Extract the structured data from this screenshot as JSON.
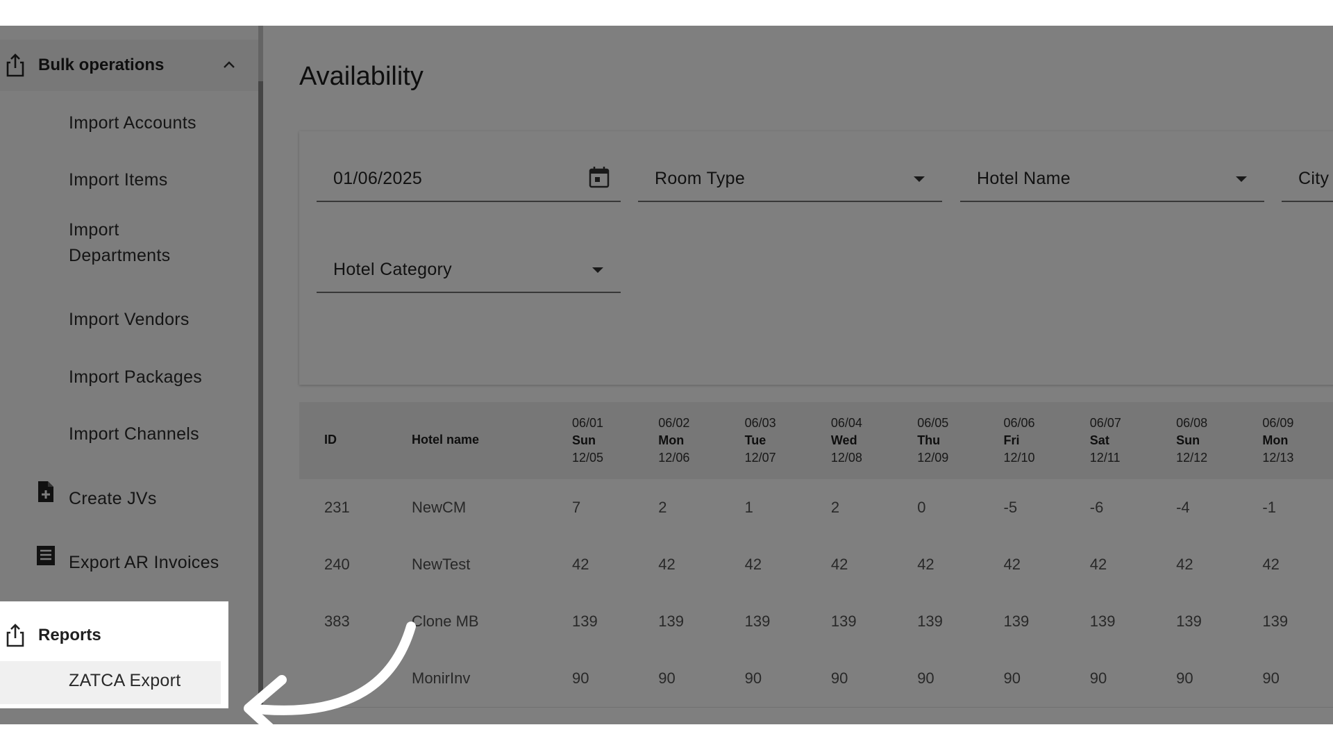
{
  "sidebar": {
    "bulk_label": "Bulk operations",
    "items": [
      {
        "label": "Import Accounts"
      },
      {
        "label": "Import Items"
      },
      {
        "label_line1": "Import",
        "label_line2": "Departments"
      },
      {
        "label": "Import Vendors"
      },
      {
        "label": "Import Packages"
      },
      {
        "label": "Import Channels"
      },
      {
        "label": "Create JVs",
        "icon": "file-plus-icon"
      },
      {
        "label": "Export AR Invoices",
        "icon": "list-document-icon"
      }
    ],
    "reports_label": "Reports",
    "reports_items": [
      {
        "label": "ZATCA Export"
      }
    ]
  },
  "main": {
    "title": "Availability",
    "filters": {
      "date": "01/06/2025",
      "room_type": "Room Type",
      "hotel_name": "Hotel Name",
      "city": "City",
      "hotel_category": "Hotel Category"
    },
    "table": {
      "col_id": "ID",
      "col_hotel": "Hotel name",
      "dates": [
        {
          "a": "06/01",
          "b": "Sun",
          "c": "12/05"
        },
        {
          "a": "06/02",
          "b": "Mon",
          "c": "12/06"
        },
        {
          "a": "06/03",
          "b": "Tue",
          "c": "12/07"
        },
        {
          "a": "06/04",
          "b": "Wed",
          "c": "12/08"
        },
        {
          "a": "06/05",
          "b": "Thu",
          "c": "12/09"
        },
        {
          "a": "06/06",
          "b": "Fri",
          "c": "12/10"
        },
        {
          "a": "06/07",
          "b": "Sat",
          "c": "12/11"
        },
        {
          "a": "06/08",
          "b": "Sun",
          "c": "12/12"
        },
        {
          "a": "06/09",
          "b": "Mon",
          "c": "12/13"
        }
      ],
      "rows": [
        {
          "id": "231",
          "name": "NewCM",
          "vals": [
            "7",
            "2",
            "1",
            "2",
            "0",
            "-5",
            "-6",
            "-4",
            "-1"
          ]
        },
        {
          "id": "240",
          "name": "NewTest",
          "vals": [
            "42",
            "42",
            "42",
            "42",
            "42",
            "42",
            "42",
            "42",
            "42"
          ]
        },
        {
          "id": "383",
          "name": "Clone MB",
          "vals": [
            "139",
            "139",
            "139",
            "139",
            "139",
            "139",
            "139",
            "139",
            "139"
          ]
        },
        {
          "id": "",
          "name": "MonirInv",
          "vals": [
            "90",
            "90",
            "90",
            "90",
            "90",
            "90",
            "90",
            "90",
            "90"
          ]
        }
      ]
    }
  },
  "colors": {
    "accent": "#1f3d7a",
    "overlay": "rgba(0,0,0,0.5)"
  }
}
